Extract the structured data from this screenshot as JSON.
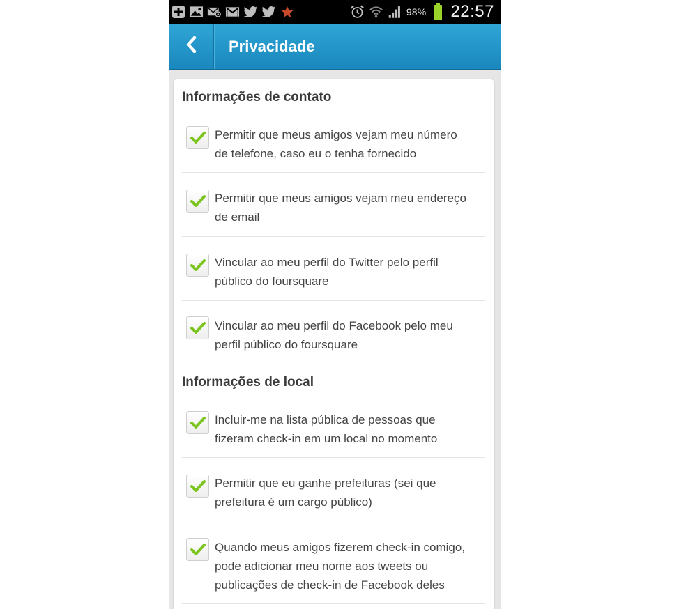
{
  "status_bar": {
    "notification_icons": [
      "plus-icon",
      "image-icon",
      "mail-at-icon",
      "gmail-icon",
      "twitter-icon",
      "twitter-icon",
      "star-icon"
    ],
    "battery_percent": "98%",
    "time": "22:57",
    "colors": {
      "battery": "#9bd22a"
    }
  },
  "app_bar": {
    "title": "Privacidade",
    "back_icon": "chevron-left-icon",
    "color": "#2a9fd2"
  },
  "sections": [
    {
      "title": "Informações de contato",
      "items": [
        {
          "lines": [
            "Permitir que meus amigos vejam meu número",
            "de telefone, caso eu o tenha fornecido"
          ],
          "checked": true
        },
        {
          "lines": [
            "Permitir que meus amigos vejam meu endereço",
            "de email"
          ],
          "checked": true
        },
        {
          "lines": [
            "Vincular ao meu perfil do Twitter pelo perfil",
            "público do foursquare"
          ],
          "checked": true
        },
        {
          "lines": [
            "Vincular ao meu perfil do Facebook pelo meu",
            "perfil público do foursquare"
          ],
          "checked": true
        }
      ]
    },
    {
      "title": "Informações de local",
      "items": [
        {
          "lines": [
            "Incluir-me na lista pública de pessoas que",
            "fizeram check-in em um local no momento"
          ],
          "checked": true
        },
        {
          "lines": [
            "Permitir que eu ganhe prefeituras (sei que",
            "prefeitura é um cargo público)"
          ],
          "checked": true
        },
        {
          "lines": [
            "Quando meus amigos fizerem check-in comigo,",
            "pode adicionar meu nome aos tweets ou",
            "publicações de check-in de Facebook deles"
          ],
          "checked": true
        }
      ]
    }
  ],
  "check_color": "#7cc520"
}
